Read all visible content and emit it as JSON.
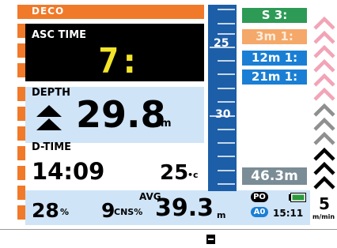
{
  "deco": {
    "label": "DECO"
  },
  "ascent": {
    "label": "ASC TIME",
    "value": "7:"
  },
  "depth": {
    "label": "DEPTH",
    "value": "29.8",
    "unit": "m"
  },
  "dive_time": {
    "label": "D-TIME",
    "value": "14:09"
  },
  "temperature": {
    "value": "25",
    "unit": "•c"
  },
  "scale": {
    "tick_upper": "25",
    "tick_lower": "30"
  },
  "stops": {
    "header": "S 3:",
    "items": [
      {
        "label": "3m 1:"
      },
      {
        "label": "12m 1:"
      },
      {
        "label": "21m 1:"
      }
    ]
  },
  "max_depth": {
    "value": "46.3m"
  },
  "bottom": {
    "o2_value": "28",
    "o2_unit": "%",
    "cns_value": "9",
    "cns_unit": "CNS%",
    "avg_label": "AVG",
    "avg_value": "39.3",
    "avg_unit": "m",
    "po_badge": "PO",
    "ao_badge": "A0",
    "clock": "15:11",
    "rate_value": "5",
    "rate_unit": "m/min"
  },
  "colors": {
    "deco_orange": "#f07a2a",
    "ascent_yellow": "#f3e42a",
    "scale_blue": "#1d5ea8",
    "stop_green": "#2d9a56",
    "stop_blue": "#1a7fd4",
    "chevron_pink": "#f2a4b6",
    "chevron_black": "#000000"
  },
  "icons": {
    "ascend": "double-up-triangle-icon",
    "battery": "battery-icon",
    "chevrons": "ascent-rate-chevrons-icon",
    "minus": "minus-icon"
  }
}
